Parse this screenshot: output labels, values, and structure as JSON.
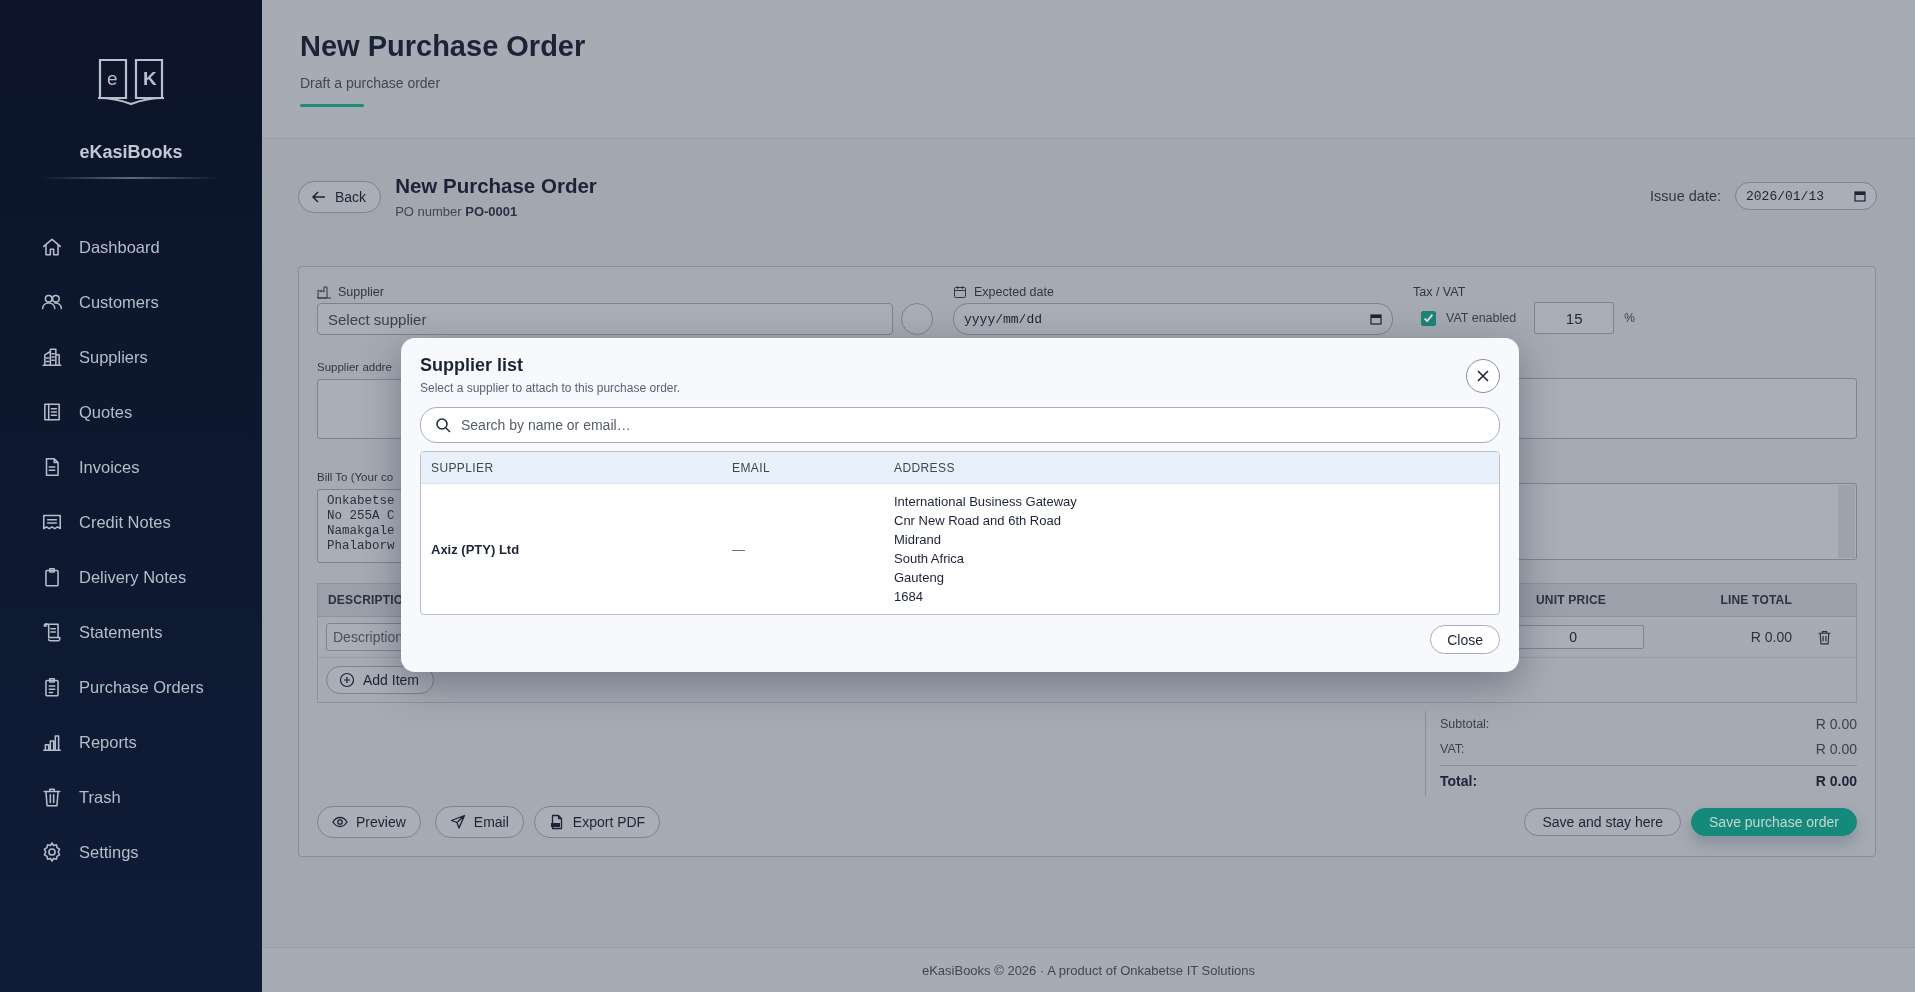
{
  "sidebar": {
    "logo_letters": [
      "e",
      "K"
    ],
    "brand": "eKasiBooks",
    "items": [
      {
        "label": "Dashboard",
        "selected": false
      },
      {
        "label": "Customers",
        "selected": false
      },
      {
        "label": "Suppliers",
        "selected": false
      },
      {
        "label": "Quotes",
        "selected": false
      },
      {
        "label": "Invoices",
        "selected": false
      },
      {
        "label": "Credit Notes",
        "selected": false
      },
      {
        "label": "Delivery Notes",
        "selected": false
      },
      {
        "label": "Statements",
        "selected": false
      },
      {
        "label": "Purchase Orders",
        "selected": false
      },
      {
        "label": "Reports",
        "selected": false
      },
      {
        "label": "Trash",
        "selected": false
      },
      {
        "label": "Settings",
        "selected": false
      }
    ]
  },
  "header": {
    "title": "New Purchase Order",
    "subtitle": "Draft a purchase order"
  },
  "order": {
    "back": "Back",
    "title": "New Purchase Order",
    "po_label": "PO number",
    "po_number": "PO-0001",
    "issue_date_label": "Issue date:",
    "issue_date": "2026/01/13"
  },
  "form": {
    "supplier_label": "Supplier",
    "supplier_placeholder": "Select supplier",
    "supplier_address_label": "Supplier addre",
    "bill_to_label": "Bill To (Your co",
    "bill_to_lines": [
      "Onkabetse",
      "No 255A C",
      "Namakgale",
      "Phalaborw"
    ],
    "expected_date_label": "Expected date",
    "expected_date_placeholder": "yyyy/mm/dd",
    "tax_label": "Tax / VAT",
    "vat_enabled": {
      "label": "VAT enabled",
      "checked": true
    },
    "vat_rate": "15",
    "vat_unit": "%"
  },
  "items": {
    "columns": [
      "DESCRIPTIO",
      "UNIT PRICE",
      "LINE TOTAL"
    ],
    "rows": [
      {
        "description_placeholder": "Description",
        "unit_price": "0",
        "line_total": "R 0.00"
      }
    ],
    "add_button": "Add Item"
  },
  "totals": [
    {
      "label": "Subtotal:",
      "value": "R 0.00",
      "kind": "normal"
    },
    {
      "label": "VAT:",
      "value": "R 0.00",
      "kind": "normal"
    },
    {
      "label": "Total:",
      "value": "R 0.00",
      "kind": "grand"
    }
  ],
  "actions": {
    "left": [
      "Preview",
      "Email",
      "Export PDF"
    ],
    "right": [
      {
        "label": "Save and stay here",
        "kind": "secondary"
      },
      {
        "label": "Save purchase order",
        "kind": "primary"
      }
    ]
  },
  "modal": {
    "title": "Supplier list",
    "subtitle": "Select a supplier to attach to this purchase order.",
    "search_placeholder": "Search by name or email…",
    "columns": [
      "SUPPLIER",
      "EMAIL",
      "ADDRESS"
    ],
    "rows": [
      {
        "supplier": "Axiz (PTY) Ltd",
        "email": "—",
        "address": [
          "International Business Gateway",
          "Cnr New Road and 6th Road",
          "Midrand",
          "South Africa",
          "Gauteng",
          "1684"
        ]
      }
    ],
    "close_button": "Close"
  },
  "footer": "eKasiBooks © 2026 · A product of Onkabetse IT Solutions"
}
